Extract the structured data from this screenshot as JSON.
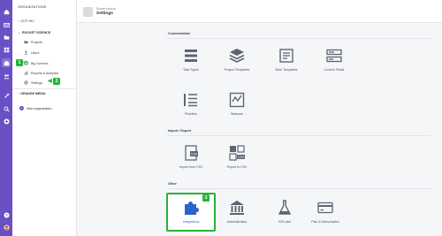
{
  "rail": {
    "icons": [
      "home-icon",
      "inbox-icon",
      "folder-icon",
      "dashboard-icon",
      "board-icon",
      "team-icon",
      "tools-icon",
      "search-icon",
      "add-icon",
      "help-icon",
      "user-avatar"
    ]
  },
  "sidebar": {
    "organizations_label": "ORGANIZATIONS",
    "org_gcp": "GCP, INC.",
    "org_rocket": "ROCKET SCIENCE",
    "links": [
      {
        "label": "Projects",
        "icon": "projects-icon"
      },
      {
        "label": "Users",
        "icon": "users-icon"
      },
      {
        "label": "Big Screens",
        "icon": "big-screens-icon"
      },
      {
        "label": "Reports & Analytics",
        "icon": "reports-icon"
      },
      {
        "label": "Settings",
        "icon": "settings-icon"
      }
    ],
    "org_orange": "ORANGE MEDIA",
    "new_org_label": "New organization"
  },
  "annotations": {
    "badge1": "1",
    "badge2": "2",
    "badge3": "3"
  },
  "header": {
    "breadcrumb": "Rocket science",
    "title": "Settings"
  },
  "sections": {
    "customization": "Customization",
    "import_export": "Import / Export",
    "other": "Other"
  },
  "tiles": {
    "task_types": "Task Types",
    "project_templates": "Project Templates",
    "note_templates": "Note Templates",
    "custom_fields": "Custom Fields",
    "priorities": "Priorities",
    "statuses": "Statuses",
    "import_csv": "Import from CSV",
    "export_csv": "Export to CSV",
    "integrations": "Integrations",
    "administration": "Administration",
    "gd_labs": "GD Labs",
    "plan_subscription": "Plan & Subscription"
  },
  "colors": {
    "brand_purple": "#6b4fc4",
    "highlight_green": "#27b23a",
    "link_blue": "#2b65c8"
  }
}
